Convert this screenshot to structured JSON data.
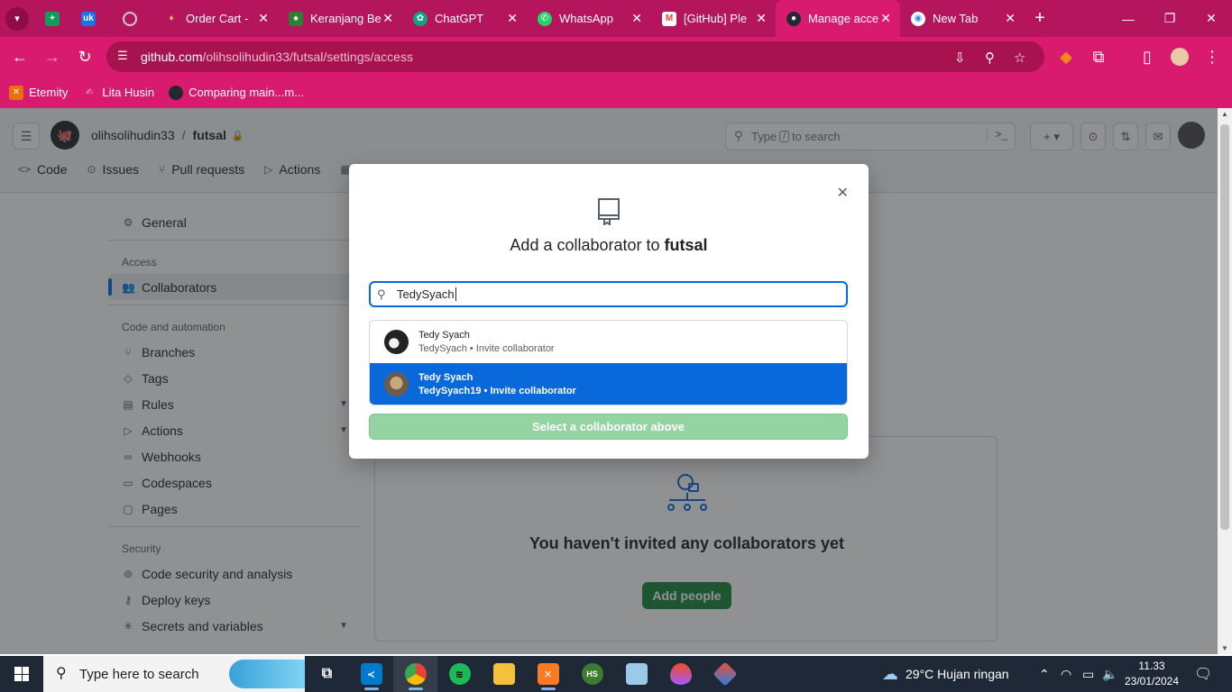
{
  "browser": {
    "tabs": [
      {
        "title": "",
        "favicon": "sheets-icon",
        "color": "#0f9d58"
      },
      {
        "title": "",
        "favicon": "uk-icon",
        "color": "#1a73e8"
      },
      {
        "title": "",
        "favicon": "globe-icon",
        "color": "#888888"
      },
      {
        "title": "Order Cart -",
        "favicon": "fire-icon",
        "color": "#e8710a"
      },
      {
        "title": "Keranjang Be",
        "favicon": "shield-icon",
        "color": "#2e7d32"
      },
      {
        "title": "ChatGPT",
        "favicon": "chatgpt-icon",
        "color": "#10a37f"
      },
      {
        "title": "WhatsApp",
        "favicon": "whatsapp-icon",
        "color": "#25d366"
      },
      {
        "title": "[GitHub] Ple",
        "favicon": "gmail-icon",
        "color": "#ea4335"
      },
      {
        "title": "Manage acce",
        "favicon": "github-icon",
        "color": "#24292f"
      },
      {
        "title": "New Tab",
        "favicon": "chrome-icon",
        "color": "#4285f4"
      }
    ],
    "url_host": "github.com",
    "url_path": "/olihsolihudin33/futsal/settings/access",
    "bookmarks": [
      {
        "label": "Etemity",
        "color": "#e8710a"
      },
      {
        "label": "Lita Husin",
        "color": "#b5155d"
      },
      {
        "label": "Comparing main...m...",
        "color": "#24292f"
      }
    ]
  },
  "github": {
    "owner": "olihsolihudin33",
    "repo": "futsal",
    "search_placeholder_pre": "Type",
    "search_placeholder_key": "/",
    "search_placeholder_post": "to search",
    "repo_nav": [
      "Code",
      "Issues",
      "Pull requests",
      "Actions"
    ],
    "sidebar": {
      "general": "General",
      "access_head": "Access",
      "collaborators": "Collaborators",
      "code_head": "Code and automation",
      "branches": "Branches",
      "tags": "Tags",
      "rules": "Rules",
      "actions": "Actions",
      "webhooks": "Webhooks",
      "codespaces": "Codespaces",
      "pages": "Pages",
      "security_head": "Security",
      "code_security": "Code security and analysis",
      "deploy_keys": "Deploy keys",
      "secrets": "Secrets and variables"
    },
    "empty_title": "You haven't invited any collaborators yet",
    "add_people": "Add people"
  },
  "modal": {
    "title_prefix": "Add a collaborator to",
    "title_repo": "futsal",
    "input_value": "TedySyach",
    "suggestions": [
      {
        "name": "Tedy Syach",
        "sub": "TedySyach • Invite collaborator",
        "selected": false
      },
      {
        "name": "Tedy Syach",
        "sub": "TedySyach19 • Invite collaborator",
        "selected": true
      }
    ],
    "select_button": "Select a collaborator above"
  },
  "taskbar": {
    "search_placeholder": "Type here to search",
    "weather": "29°C  Hujan ringan",
    "time": "11.33",
    "date": "23/01/2024"
  },
  "colors": {
    "browser_frame": "#d81b6e",
    "github_blue": "#0969da",
    "github_green": "#1f883d"
  }
}
